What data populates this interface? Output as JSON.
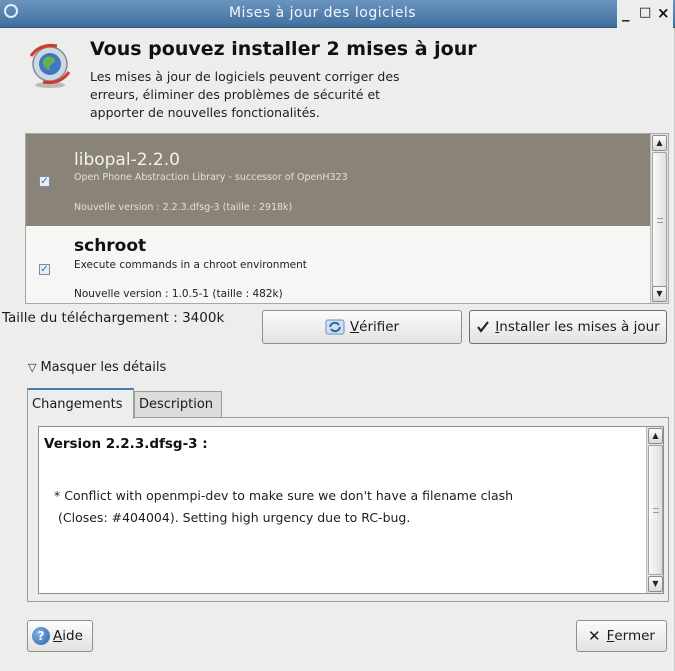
{
  "window": {
    "title": "Mises à jour des logiciels",
    "minimize_glyph": "_",
    "maximize_glyph": "□",
    "close_glyph": "×"
  },
  "header": {
    "icon": "globe-update-icon",
    "headline": "Vous pouvez installer 2 mises à jour",
    "subtext_line1": "Les mises à jour de logiciels peuvent corriger des",
    "subtext_line2": "erreurs, éliminer des problèmes de sécurité et",
    "subtext_line3": "apporter de nouvelles fonctionalités."
  },
  "updates": [
    {
      "name": "libopal-2.2.0",
      "description": "Open Phone Abstraction Library - successor of OpenH323",
      "version": "Nouvelle version : 2.2.3.dfsg-3 (taille : 2918k)",
      "checked": true,
      "selected": true
    },
    {
      "name": "schroot",
      "description": "Execute commands in a chroot environment",
      "version": "Nouvelle version : 1.0.5-1 (taille : 482k)",
      "checked": true,
      "selected": false
    }
  ],
  "download": {
    "size_label": "Taille du téléchargement : 3400k"
  },
  "buttons": {
    "verify_first": "V",
    "verify_rest": "érifier",
    "install_first": "I",
    "install_rest": "nstaller les mises à jour",
    "help_first": "A",
    "help_rest": "ide",
    "close_first": "F",
    "close_rest": "ermer"
  },
  "details": {
    "toggle_label": "Masquer les détails",
    "tabs": [
      "Changements",
      "Description"
    ],
    "active_tab": "Changements",
    "version_heading": "Version 2.2.3.dfsg-3 :",
    "change_line1": "* Conflict with openmpi-dev to make sure we don't have a filename clash",
    "change_line2": "(Closes: #404004). Setting high urgency due to RC-bug."
  },
  "colors": {
    "titlebar": "#4f7fae",
    "selected_row": "#8a8378",
    "window_bg": "#ededeb",
    "tab_accent": "#4a7bb5"
  }
}
